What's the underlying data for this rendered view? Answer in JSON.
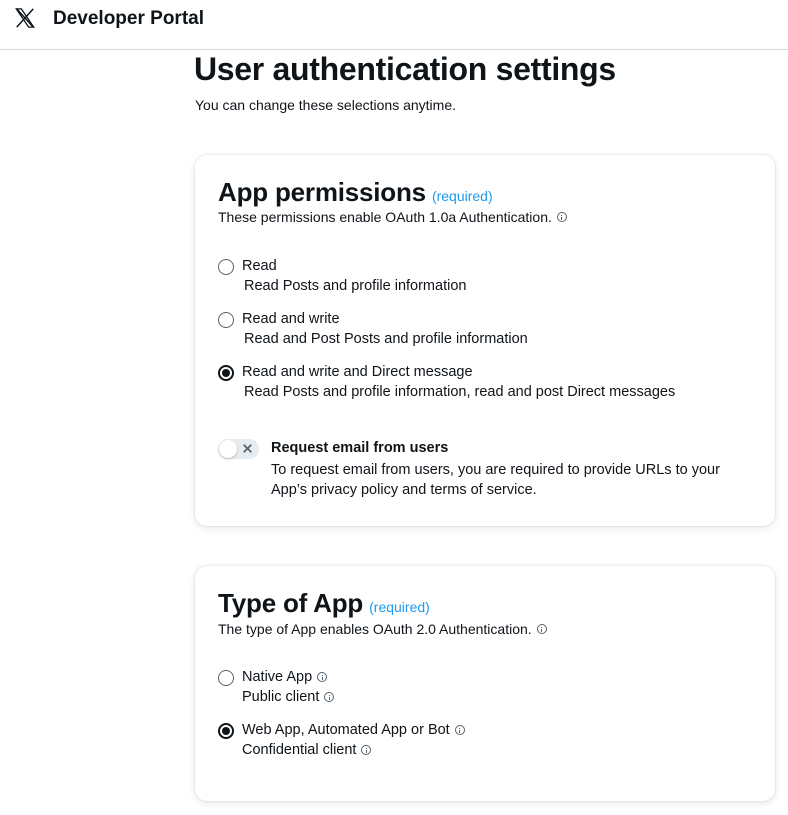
{
  "header": {
    "brand": "Developer Portal",
    "logo_icon": "x-logo-icon"
  },
  "page": {
    "title": "User authentication settings",
    "subtitle": "You can change these selections anytime."
  },
  "app_permissions": {
    "title": "App permissions",
    "required": "(required)",
    "description": "These permissions enable OAuth 1.0a Authentication.",
    "options": [
      {
        "label": "Read",
        "description": "Read Posts and profile information",
        "selected": false
      },
      {
        "label": "Read and write",
        "description": "Read and Post Posts and profile information",
        "selected": false
      },
      {
        "label": "Read and write and Direct message",
        "description": "Read Posts and profile information, read and post Direct messages",
        "selected": true
      }
    ],
    "email_toggle": {
      "label": "Request email from users",
      "description": "To request email from users, you are required to provide URLs to your App’s privacy policy and terms of service.",
      "enabled": false
    }
  },
  "type_of_app": {
    "title": "Type of App",
    "required": "(required)",
    "description": "The type of App enables OAuth 2.0 Authentication.",
    "options": [
      {
        "label": "Native App",
        "description": "Public client",
        "selected": false
      },
      {
        "label": "Web App, Automated App or Bot",
        "description": "Confidential client",
        "selected": true
      }
    ]
  },
  "colors": {
    "accent": "#1d9bf0",
    "text": "#0f1419",
    "border": "#cfd9de"
  }
}
